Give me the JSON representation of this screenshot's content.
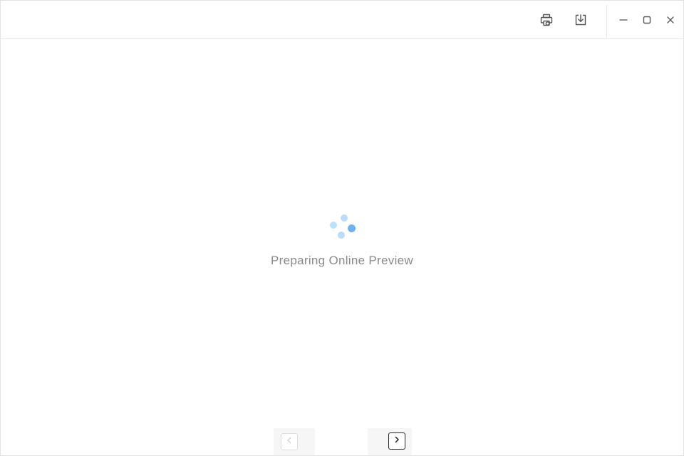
{
  "titlebar": {
    "print_icon": "print-icon",
    "download_icon": "download-icon",
    "minimize_icon": "minimize-icon",
    "maximize_icon": "maximize-icon",
    "close_icon": "close-icon"
  },
  "content": {
    "loading_text": "Preparing Online Preview",
    "spinner_icon": "loading-spinner-icon"
  },
  "pager": {
    "prev_icon": "chevron-left-icon",
    "next_icon": "chevron-right-icon"
  },
  "colors": {
    "spinner_light": "#b9dcfb",
    "spinner_dark": "#6fb2f2",
    "text_muted": "#8a8a8a",
    "icon_gray": "#555555"
  }
}
